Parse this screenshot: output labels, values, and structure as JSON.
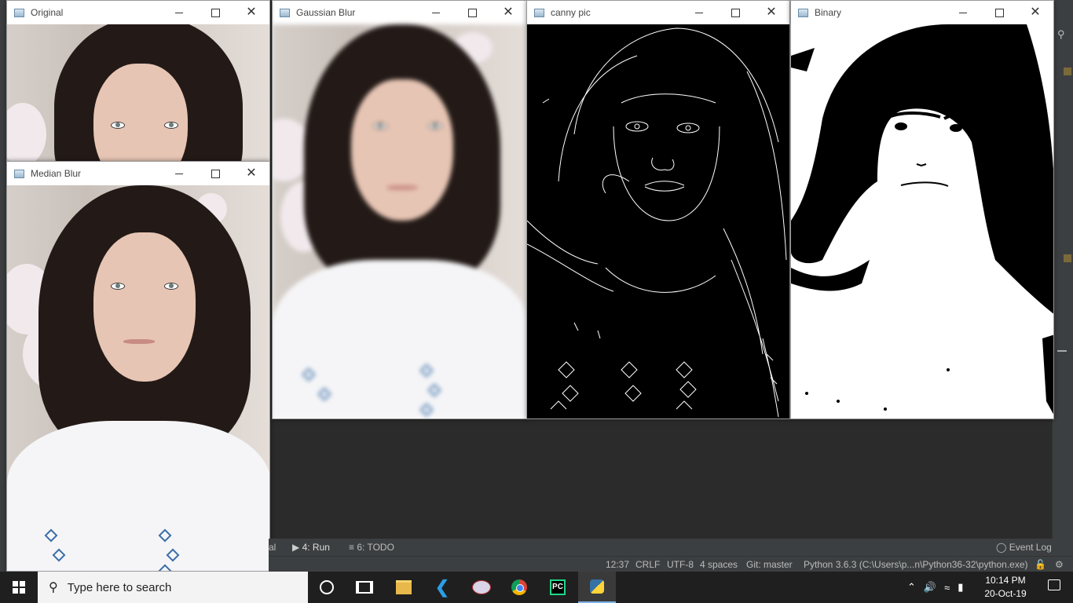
{
  "windows": {
    "original": {
      "title": "Original"
    },
    "median": {
      "title": "Median Blur"
    },
    "gaussian": {
      "title": "Gaussian Blur"
    },
    "canny": {
      "title": "canny pic"
    },
    "binary": {
      "title": "Binary"
    }
  },
  "window_controls": {
    "minimize": "—",
    "maximize": "☐",
    "close": "✕"
  },
  "ide": {
    "toolstrip": {
      "partial_tab": "al",
      "run_tab": "4: Run",
      "todo_tab": "6: TODO",
      "event_log": "Event Log"
    },
    "status": {
      "position": "12:37",
      "line_sep": "CRLF",
      "encoding": "UTF-8",
      "indent": "4 spaces",
      "vcs": "Git: master",
      "interpreter": "Python 3.6.3 (C:\\Users\\p...n\\Python36-32\\python.exe)"
    }
  },
  "taskbar": {
    "search_placeholder": "Type here to search",
    "time": "10:14 PM",
    "date": "20-Oct-19",
    "pinned_icons": [
      "cortana-icon",
      "task-view-icon",
      "file-explorer-icon",
      "vscode-icon",
      "paint-icon",
      "chrome-icon",
      "pycharm-icon",
      "python-icon"
    ]
  },
  "colors": {
    "ide_bg": "#2b2b2b",
    "taskbar": "#1f1f1f",
    "canny_bg": "#000000",
    "binary_bg": "#ffffff"
  }
}
